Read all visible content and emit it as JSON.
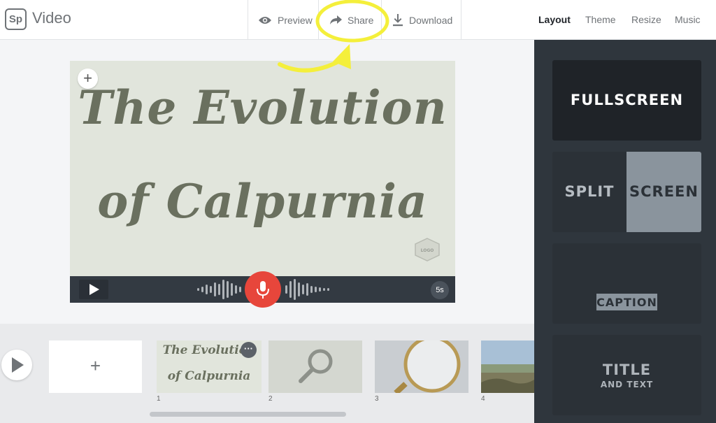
{
  "app": {
    "logo": "Sp",
    "title": "Video"
  },
  "toolbar": {
    "preview_label": "Preview",
    "share_label": "Share",
    "download_label": "Download"
  },
  "tabs": [
    "Layout",
    "Theme",
    "Resize",
    "Music"
  ],
  "active_tab": "Layout",
  "canvas": {
    "title_line1": "The Evolution",
    "title_line2": "of Calpurnia",
    "logo_badge": "LOGO",
    "duration": "5s"
  },
  "timeline": {
    "thumbs": [
      {
        "number": "1",
        "line1": "The Evolution",
        "line2": "of Calpurnia"
      },
      {
        "number": "2"
      },
      {
        "number": "3"
      },
      {
        "number": "4"
      }
    ]
  },
  "layouts": {
    "fullscreen": "FULLSCREEN",
    "split_left": "SPLIT",
    "split_right": "SCREEN",
    "caption": "CAPTION",
    "title": "TITLE",
    "title_sub": "AND TEXT"
  },
  "colors": {
    "accent_red": "#e7463b",
    "panel": "#2f363d",
    "highlight": "#f4ef3b"
  }
}
